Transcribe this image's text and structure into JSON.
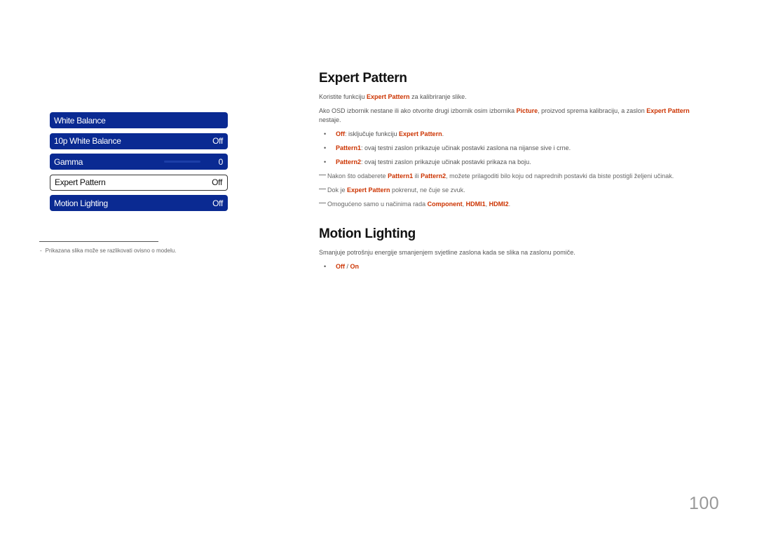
{
  "osd_menu": {
    "rows": [
      {
        "label": "White Balance",
        "value": "",
        "selected": false
      },
      {
        "label": "10p White Balance",
        "value": "Off",
        "selected": false
      },
      {
        "label": "Gamma",
        "value": "0",
        "selected": false
      },
      {
        "label": "Expert Pattern",
        "value": "Off",
        "selected": true
      },
      {
        "label": "Motion Lighting",
        "value": "Off",
        "selected": false
      }
    ]
  },
  "footnote": {
    "bullet": "-",
    "text": "Prikazana slika može se razlikovati ovisno o modelu."
  },
  "expert_pattern": {
    "title": "Expert Pattern",
    "intro": {
      "pre": "Koristite funkciju ",
      "hl": "Expert Pattern",
      "post": " za kalibriranje slike."
    },
    "para2": {
      "pre": "Ako OSD izbornik nestane ili ako otvorite drugi izbornik osim izbornika ",
      "hl1": "Picture",
      "mid": ", proizvod sprema kalibraciju, a zaslon ",
      "hl2": "Expert Pattern",
      "post": " nestaje."
    },
    "bullets": [
      {
        "hl": "Off",
        "text": ": isključuje funkciju ",
        "hl2": "Expert Pattern",
        "post": "."
      },
      {
        "hl": "Pattern1",
        "text": ": ovaj testni zaslon prikazuje učinak postavki zaslona na nijanse sive i crne."
      },
      {
        "hl": "Pattern2",
        "text": ": ovaj testni zaslon prikazuje učinak postavki prikaza na boju."
      }
    ],
    "notes": [
      {
        "pre": "Nakon što odaberete ",
        "hl1": "Pattern1",
        "mid": " ili ",
        "hl2": "Pattern2",
        "post": ", možete prilagoditi bilo koju od naprednih postavki da biste postigli željeni učinak."
      },
      {
        "pre": "Dok je ",
        "hl1": "Expert Pattern",
        "post": " pokrenut, ne čuje se zvuk."
      },
      {
        "pre": "Omogućeno samo u načinima rada ",
        "hl1": "Component",
        "sep1": ", ",
        "hl2": "HDMI1",
        "sep2": ", ",
        "hl3": "HDMI2",
        "post": "."
      }
    ]
  },
  "motion_lighting": {
    "title": "Motion Lighting",
    "desc": "Smanjuje potrošnju energije smanjenjem svjetline zaslona kada se slika na zaslonu pomiče.",
    "options": {
      "off": "Off",
      "sep": " / ",
      "on": "On"
    }
  },
  "page_number": "100",
  "colors": {
    "menu_blue": "#0a2a92",
    "highlight": "#cc3300"
  }
}
